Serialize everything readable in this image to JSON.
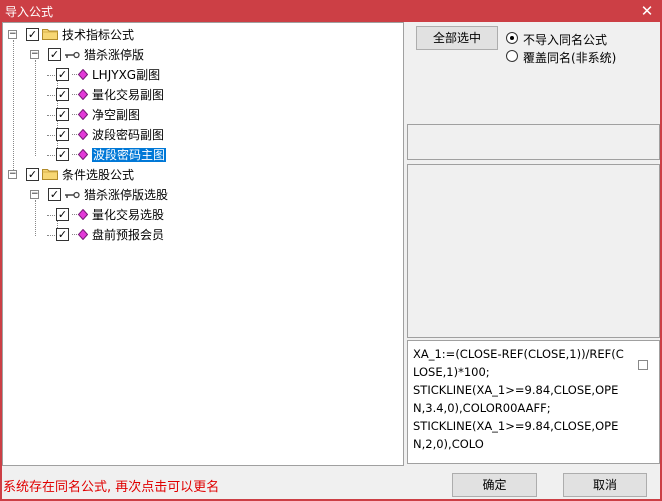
{
  "window": {
    "title": "导入公式",
    "close_glyph": "✕"
  },
  "tree": [
    {
      "label": "技术指标公式",
      "type": "folder",
      "checked": true,
      "expanded": true
    },
    {
      "label": "猎杀涨停版",
      "type": "group",
      "checked": true,
      "expanded": true
    },
    {
      "label": "LHJYXG副图",
      "type": "formula",
      "checked": true
    },
    {
      "label": "量化交易副图",
      "type": "formula",
      "checked": true
    },
    {
      "label": "净空副图",
      "type": "formula",
      "checked": true
    },
    {
      "label": "波段密码副图",
      "type": "formula",
      "checked": true
    },
    {
      "label": "波段密码主图",
      "type": "formula",
      "checked": true,
      "selected": true
    },
    {
      "label": "条件选股公式",
      "type": "folder",
      "checked": true,
      "expanded": true
    },
    {
      "label": "猎杀涨停版选股",
      "type": "group",
      "checked": true,
      "expanded": true
    },
    {
      "label": "量化交易选股",
      "type": "formula",
      "checked": true
    },
    {
      "label": "盘前预报会员",
      "type": "formula",
      "checked": true
    }
  ],
  "buttons": {
    "select_all": "全部选中",
    "ok": "确定",
    "cancel": "取消"
  },
  "options": {
    "no_import_same_name": "不导入同名公式",
    "overwrite_same_name": "覆盖同名(非系统)",
    "selected": "no_import_same_name"
  },
  "formula_preview": "XA_1:=(CLOSE-REF(CLOSE,1))/REF(CLOSE,1)*100;\nSTICKLINE(XA_1>=9.84,CLOSE,OPEN,3.4,0),COLOR00AAFF;\nSTICKLINE(XA_1>=9.84,CLOSE,OPEN,2,0),COLO",
  "status_message": "系统存在同名公式, 再次点击可以更名",
  "colors": {
    "accent": "#cc3f45",
    "selection": "#0078d7",
    "status_text": "#e00000"
  }
}
